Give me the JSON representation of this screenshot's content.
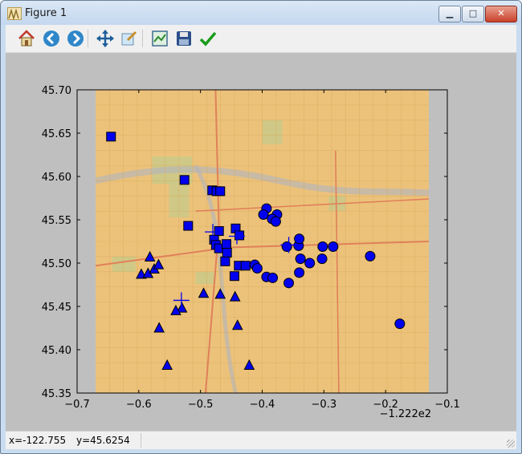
{
  "window": {
    "title": "Figure 1",
    "minimize_glyph": "▁",
    "maximize_glyph": "□",
    "close_glyph": "✕"
  },
  "toolbar": {
    "tools": [
      "home-icon",
      "back-arrow-icon",
      "forward-arrow-icon",
      "pan-icon",
      "zoom-icon",
      "subplots-icon",
      "save-icon",
      "check-icon"
    ]
  },
  "status": {
    "x_text": "x=-122.755",
    "y_text": "y=45.6254"
  },
  "chart_data": {
    "type": "scatter",
    "title": "",
    "xlabel": "",
    "ylabel": "",
    "xlim": [
      -0.7,
      -0.1
    ],
    "ylim": [
      45.35,
      45.7
    ],
    "x_offset_label": "−1.222e2",
    "xticks": [
      -0.7,
      -0.6,
      -0.5,
      -0.4,
      -0.3,
      -0.2,
      -0.1
    ],
    "xtick_labels": [
      "−0.7",
      "−0.6",
      "−0.5",
      "−0.4",
      "−0.3",
      "−0.2",
      "−0.1"
    ],
    "yticks": [
      45.35,
      45.4,
      45.45,
      45.5,
      45.55,
      45.6,
      45.65,
      45.7
    ],
    "ytick_labels": [
      "45.35",
      "45.40",
      "45.45",
      "45.50",
      "45.55",
      "45.60",
      "45.65",
      "45.70"
    ],
    "grid": false,
    "background": "street map",
    "image_extent": {
      "x": [
        -0.67,
        -0.13
      ],
      "y": [
        45.35,
        45.7
      ]
    },
    "marker_color": "#0000ee",
    "series": [
      {
        "marker": "square",
        "points": [
          [
            -0.645,
            45.646
          ],
          [
            -0.526,
            45.596
          ],
          [
            -0.481,
            45.584
          ],
          [
            -0.474,
            45.583
          ],
          [
            -0.468,
            45.583
          ],
          [
            -0.52,
            45.543
          ],
          [
            -0.478,
            45.527
          ],
          [
            -0.47,
            45.537
          ],
          [
            -0.475,
            45.521
          ],
          [
            -0.47,
            45.517
          ],
          [
            -0.458,
            45.522
          ],
          [
            -0.457,
            45.512
          ],
          [
            -0.46,
            45.502
          ],
          [
            -0.443,
            45.54
          ],
          [
            -0.437,
            45.532
          ],
          [
            -0.438,
            45.497
          ],
          [
            -0.427,
            45.497
          ],
          [
            -0.445,
            45.485
          ]
        ]
      },
      {
        "marker": "circle",
        "points": [
          [
            -0.393,
            45.563
          ],
          [
            -0.398,
            45.556
          ],
          [
            -0.376,
            45.556
          ],
          [
            -0.384,
            45.551
          ],
          [
            -0.378,
            45.548
          ],
          [
            -0.36,
            45.519
          ],
          [
            -0.341,
            45.52
          ],
          [
            -0.34,
            45.528
          ],
          [
            -0.338,
            45.505
          ],
          [
            -0.323,
            45.5
          ],
          [
            -0.302,
            45.519
          ],
          [
            -0.285,
            45.519
          ],
          [
            -0.303,
            45.505
          ],
          [
            -0.412,
            45.498
          ],
          [
            -0.408,
            45.494
          ],
          [
            -0.393,
            45.484
          ],
          [
            -0.383,
            45.483
          ],
          [
            -0.357,
            45.477
          ],
          [
            -0.34,
            45.489
          ],
          [
            -0.225,
            45.508
          ],
          [
            -0.177,
            45.43
          ]
        ]
      },
      {
        "marker": "triangle",
        "points": [
          [
            -0.582,
            45.507
          ],
          [
            -0.596,
            45.487
          ],
          [
            -0.585,
            45.488
          ],
          [
            -0.575,
            45.493
          ],
          [
            -0.568,
            45.498
          ],
          [
            -0.495,
            45.465
          ],
          [
            -0.468,
            45.464
          ],
          [
            -0.444,
            45.461
          ],
          [
            -0.53,
            45.448
          ],
          [
            -0.54,
            45.445
          ],
          [
            -0.567,
            45.425
          ],
          [
            -0.44,
            45.428
          ],
          [
            -0.421,
            45.382
          ],
          [
            -0.554,
            45.382
          ]
        ]
      },
      {
        "marker": "plus",
        "points": [
          [
            -0.48,
            45.536
          ],
          [
            -0.441,
            45.531
          ],
          [
            -0.357,
            45.521
          ],
          [
            -0.531,
            45.457
          ]
        ]
      }
    ]
  }
}
